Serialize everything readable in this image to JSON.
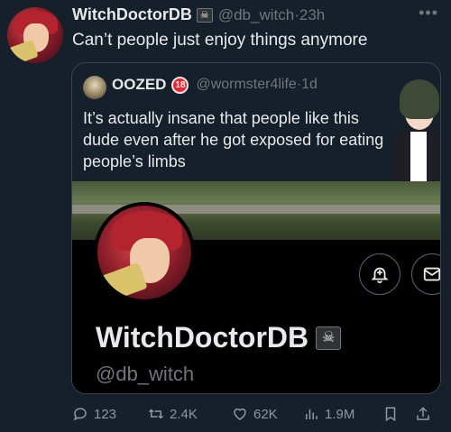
{
  "tweet": {
    "author_name": "WitchDoctorDB",
    "author_flag": "☠",
    "author_handle": "@db_witch",
    "time": "23h",
    "more_icon": "more-icon",
    "text": "Can’t people just enjoy things anymore"
  },
  "quote": {
    "author_name": "OOZED",
    "badge": "18",
    "author_handle": "@wormster4life",
    "time": "1d",
    "text": "It’s actually insane that people like this dude even after he got exposed for eating people’s limbs"
  },
  "profile_card": {
    "name": "WitchDoctorDB",
    "flag": "☠",
    "handle": "@db_witch"
  },
  "actions": {
    "reply_count": "123",
    "retweet_count": "2.4K",
    "like_count": "62K",
    "views_count": "1.9M"
  },
  "colors": {
    "background": "#15202b",
    "text": "#e7e9ea",
    "muted": "#71767b",
    "border": "#38444d"
  }
}
